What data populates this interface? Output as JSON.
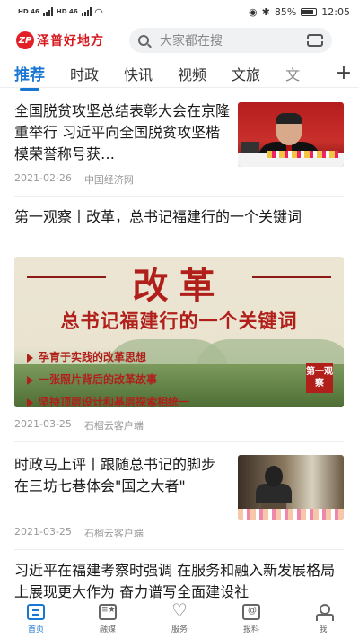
{
  "status_bar": {
    "left_labels": [
      "HD 46",
      "HD 46"
    ],
    "battery": "85%",
    "time": "12:05"
  },
  "header": {
    "logo_mark": "ZP",
    "logo_text": "泽普好地方",
    "search_placeholder": "大家都在搜"
  },
  "tabs": [
    {
      "label": "推荐",
      "active": true
    },
    {
      "label": "时政"
    },
    {
      "label": "快讯"
    },
    {
      "label": "视频"
    },
    {
      "label": "文旅"
    },
    {
      "label": "文"
    }
  ],
  "feed": [
    {
      "title": "全国脱贫攻坚总结表彰大会在京隆重举行 习近平向全国脱贫攻坚楷模荣誉称号获…",
      "date": "2021-02-26",
      "source": "中国经济网"
    },
    {
      "title": "第一观察丨改革，总书记福建行的一个关键词",
      "banner": {
        "headline": "改革",
        "subtitle": "总书记福建行的一个关键词",
        "bullets": [
          "孕育于实践的改革思想",
          "一张照片背后的改革故事",
          "坚持顶层设计和基层探索相统一"
        ],
        "seal": "第一观察"
      },
      "date": "2021-03-25",
      "source": "石榴云客户端"
    },
    {
      "title": "时政马上评丨跟随总书记的脚步 在三坊七巷体会\"国之大者\"",
      "date": "2021-03-25",
      "source": "石榴云客户端"
    },
    {
      "title": "习近平在福建考察时强调 在服务和融入新发展格局上展现更大作为 奋力谱写全面建设社"
    }
  ],
  "bottom_nav": [
    {
      "label": "首页",
      "active": true
    },
    {
      "label": "融媒"
    },
    {
      "label": "服务"
    },
    {
      "label": "报料"
    },
    {
      "label": "我"
    }
  ]
}
